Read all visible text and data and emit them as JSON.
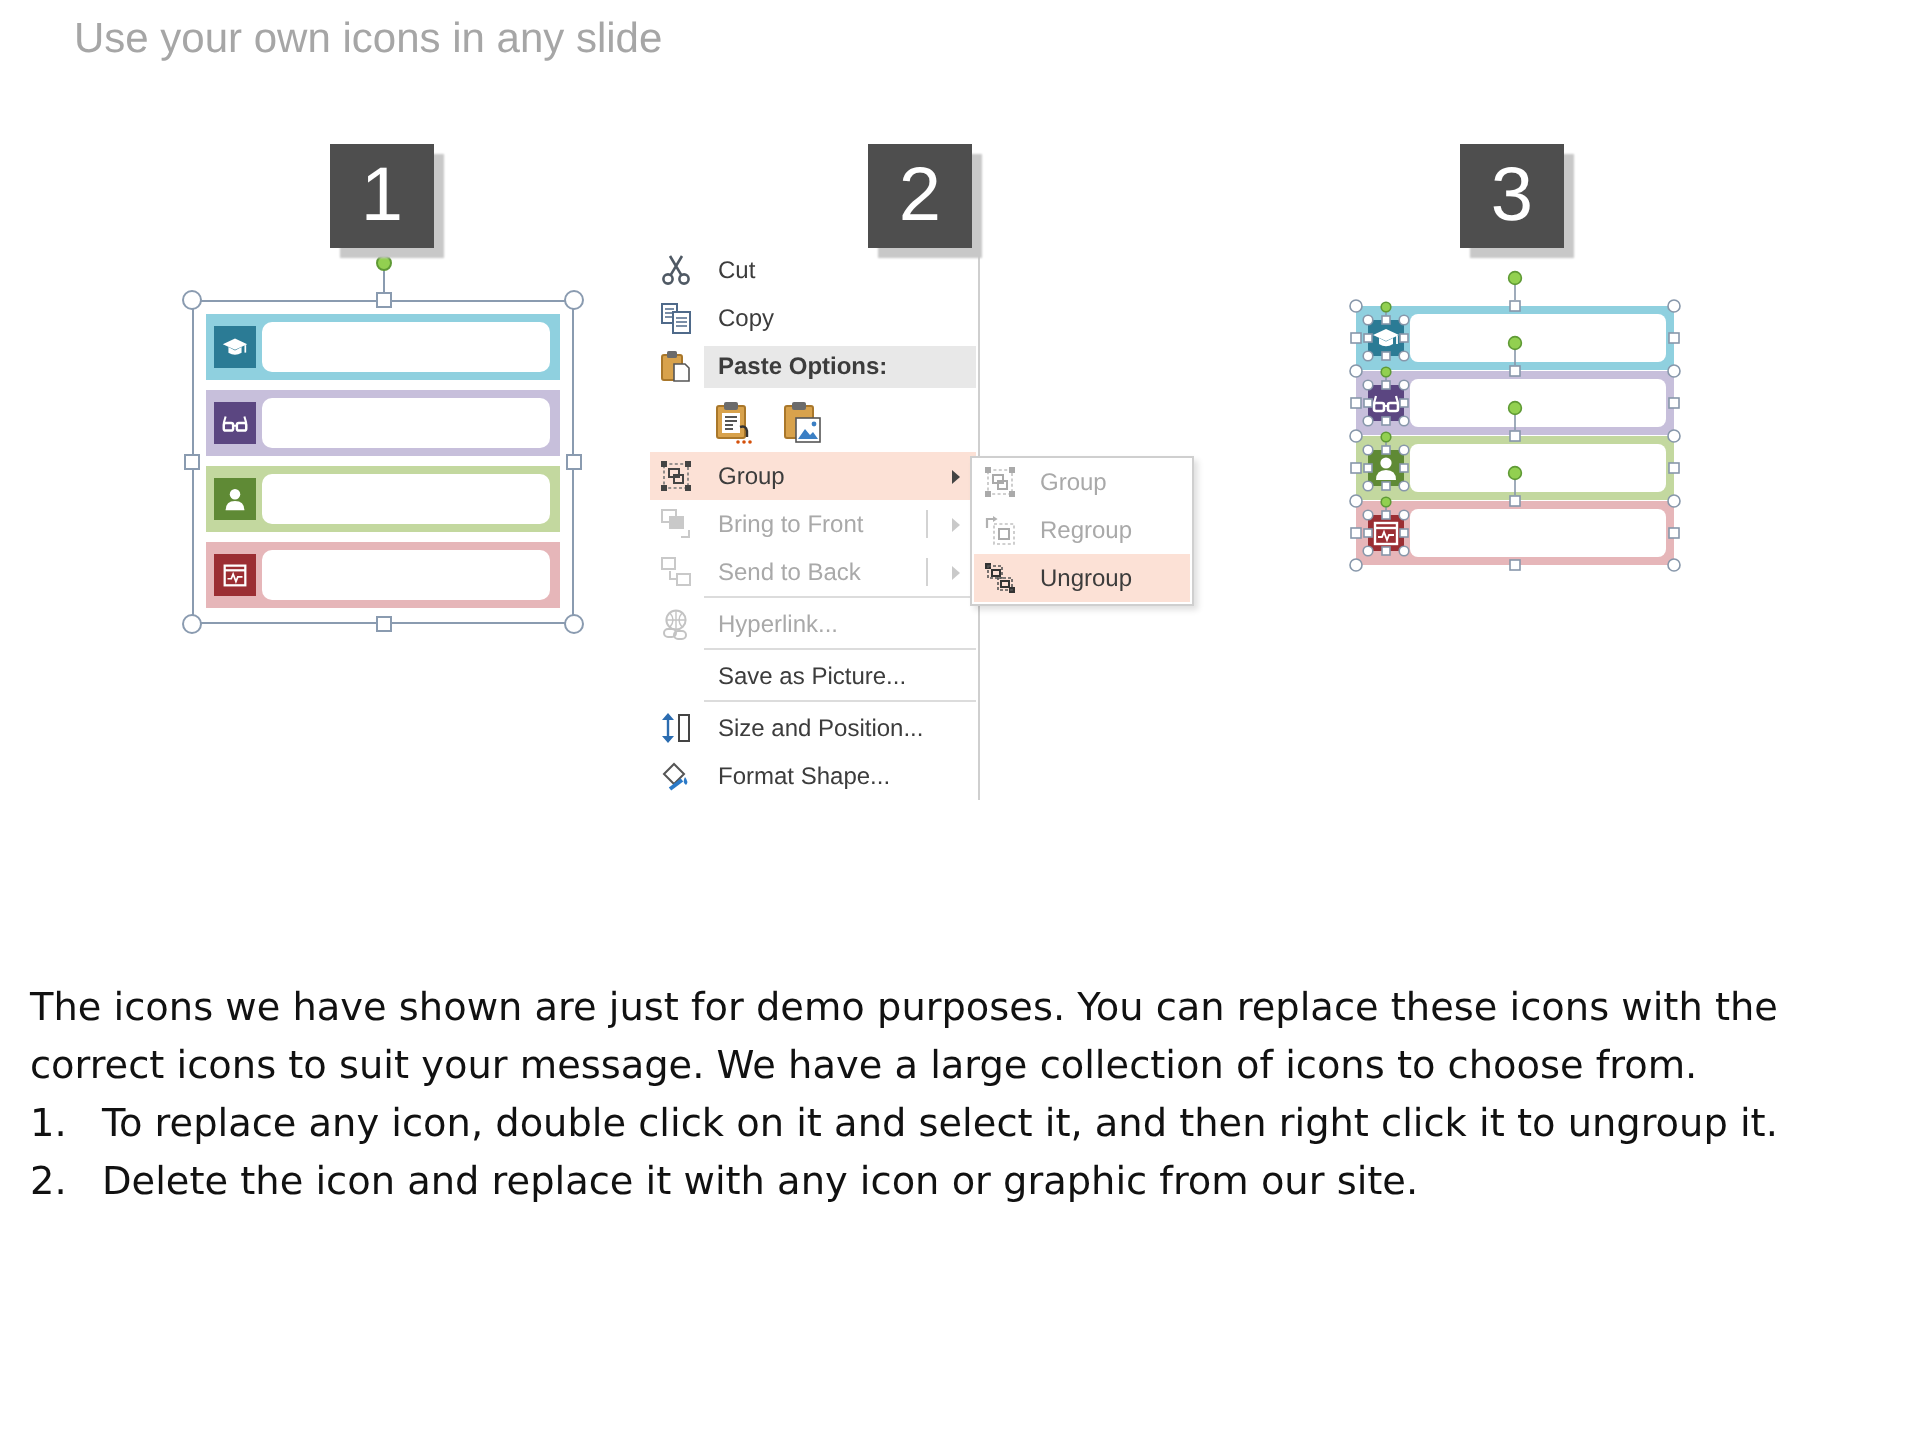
{
  "slide": {
    "title": "Use your own icons in any slide"
  },
  "steps": [
    {
      "number": "1",
      "kind": "grouped",
      "group": {
        "selected": true,
        "rows": [
          {
            "color": "#8fd0df",
            "icon": {
              "color": "#2b7b95"
            }
          },
          {
            "color": "#c7bfdb",
            "icon": {
              "color": "#5b4681"
            }
          },
          {
            "color": "#c3d89f",
            "icon": {
              "color": "#5f8a35"
            }
          },
          {
            "color": "#e6b6b9",
            "icon": {
              "color": "#9b2e33"
            }
          }
        ]
      }
    },
    {
      "number": "2",
      "kind": "context_menu",
      "menu": {
        "items": [
          {
            "kind": "command",
            "label": "Cut",
            "disabled": false,
            "selected": false,
            "has_submenu": false,
            "split": false,
            "separator_above": false
          },
          {
            "kind": "command",
            "label": "Copy",
            "disabled": false,
            "selected": false,
            "has_submenu": false,
            "split": false,
            "separator_above": false
          },
          {
            "kind": "header",
            "label": "Paste Options:"
          },
          {
            "kind": "paste_buttons"
          },
          {
            "kind": "command",
            "label": "Group",
            "disabled": false,
            "selected": true,
            "has_submenu": true,
            "expanded": true,
            "split": false,
            "separator_above": false,
            "submenu": [
              {
                "label": "Group",
                "disabled": true,
                "selected": false
              },
              {
                "label": "Regroup",
                "disabled": true,
                "selected": false
              },
              {
                "label": "Ungroup",
                "disabled": false,
                "selected": true
              }
            ]
          },
          {
            "kind": "command",
            "label": "Bring to Front",
            "disabled": true,
            "selected": false,
            "has_submenu": true,
            "expanded": false,
            "split": true,
            "separator_above": false
          },
          {
            "kind": "command",
            "label": "Send to Back",
            "disabled": true,
            "selected": false,
            "has_submenu": true,
            "expanded": false,
            "split": true,
            "separator_above": false
          },
          {
            "kind": "command",
            "label": "Hyperlink...",
            "disabled": true,
            "selected": false,
            "has_submenu": false,
            "split": false,
            "separator_above": true
          },
          {
            "kind": "command",
            "label": "Save as Picture...",
            "disabled": false,
            "selected": false,
            "has_submenu": false,
            "split": false,
            "separator_above": true
          },
          {
            "kind": "command",
            "label": "Size and Position...",
            "disabled": false,
            "selected": false,
            "has_submenu": false,
            "split": false,
            "separator_above": true
          },
          {
            "kind": "command",
            "label": "Format Shape...",
            "disabled": false,
            "selected": false,
            "has_submenu": false,
            "split": false,
            "separator_above": false
          }
        ]
      }
    },
    {
      "number": "3",
      "kind": "ungrouped",
      "shapes": [
        {
          "color": "#8fd0df",
          "selected": true,
          "icon": {
            "color": "#2b7b95",
            "selected": true
          }
        },
        {
          "color": "#c7bfdb",
          "selected": true,
          "icon": {
            "color": "#5b4681",
            "selected": true
          }
        },
        {
          "color": "#c3d89f",
          "selected": true,
          "icon": {
            "color": "#5f8a35",
            "selected": true
          }
        },
        {
          "color": "#e6b6b9",
          "selected": true,
          "icon": {
            "color": "#9b2e33",
            "selected": true
          }
        }
      ]
    }
  ],
  "description": "The icons we have shown are just for demo purposes. You can replace these icons with the correct icons to suit your message. We have a large collection of icons to choose from.",
  "instructions": [
    {
      "number": "1.",
      "text": "To replace any icon, double click on it and select it, and then right click it to ungroup it."
    },
    {
      "number": "2.",
      "text": "Delete the icon and replace it with any icon or graphic from our site."
    }
  ]
}
